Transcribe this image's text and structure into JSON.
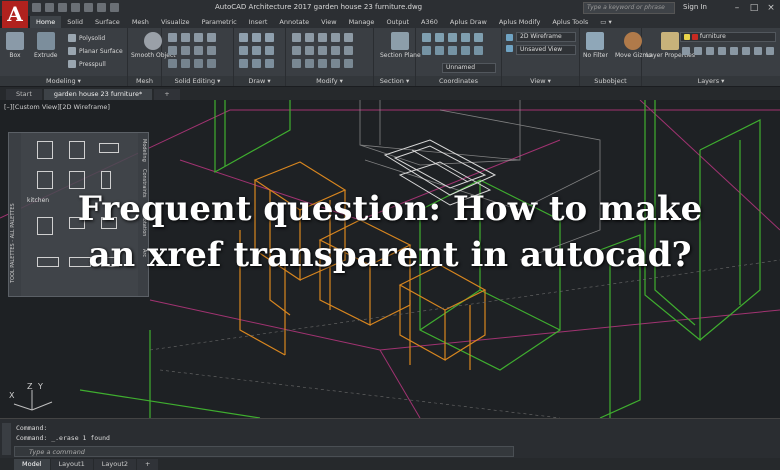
{
  "app": {
    "logo_letter": "A"
  },
  "titlebar": {
    "title": "AutoCAD Architecture 2017   garden house 23 furniture.dwg",
    "search_placeholder": "Type a keyword or phrase",
    "signin": "Sign In",
    "minimize": "–",
    "maximize": "□",
    "close": "×"
  },
  "ribbon_tabs": [
    "Home",
    "Solid",
    "Surface",
    "Mesh",
    "Visualize",
    "Parametric",
    "Insert",
    "Annotate",
    "View",
    "Manage",
    "Output",
    "A360",
    "Aplus Draw",
    "Aplus Modify",
    "Aplus Tools",
    "▭ ▾"
  ],
  "ribbon": {
    "modeling": {
      "label": "Modeling ▾",
      "box": "Box",
      "extrude": "Extrude",
      "polysolid": "Polysolid",
      "planar_surface": "Planar Surface",
      "presspull": "Presspull"
    },
    "mesh": {
      "label": "Mesh",
      "smooth": "Smooth Object"
    },
    "solid_editing": {
      "label": "Solid Editing ▾"
    },
    "draw": {
      "label": "Draw ▾"
    },
    "modify": {
      "label": "Modify ▾"
    },
    "section": {
      "label": "Section ▾",
      "section_plane": "Section Plane"
    },
    "coordinates": {
      "label": "Coordinates",
      "unnamed": "Unnamed"
    },
    "view": {
      "label": "View ▾",
      "visual_style": "2D Wireframe",
      "saved_view": "Unsaved View"
    },
    "subobject": {
      "label": "Subobject",
      "no_filter": "No Filter",
      "move_gizmo": "Move Gizmo"
    },
    "layers": {
      "label": "Layers ▾",
      "layer_properties": "Layer Properties",
      "current_layer": "furniture"
    }
  },
  "doc_tabs": [
    "Start",
    "garden house 23 furniture*",
    "+"
  ],
  "viewport": {
    "label": "[–][Custom View][2D Wireframe]"
  },
  "tool_palette": {
    "strip_label": "TOOL PALETTES - ALL PALETTES",
    "tabs": [
      "Modeling",
      "Constraints",
      "Annotation",
      "Arc"
    ],
    "kitchen_label": "kitchen"
  },
  "headline": {
    "line1": "Frequent question: How to make",
    "line2": "an xref transparent in autocad?"
  },
  "ucs": {
    "x": "X",
    "y": "Y",
    "z": "Z"
  },
  "command": {
    "line1": "Command:",
    "line2": "Command: _.erase 1 found",
    "placeholder": "Type a command"
  },
  "layout_tabs": [
    "Model",
    "Layout1",
    "Layout2",
    "+"
  ],
  "colors": {
    "accent_red": "#b0221e",
    "wire_green": "#3fae2f",
    "wire_orange": "#d8861f",
    "wire_pink": "#c03a8c"
  }
}
